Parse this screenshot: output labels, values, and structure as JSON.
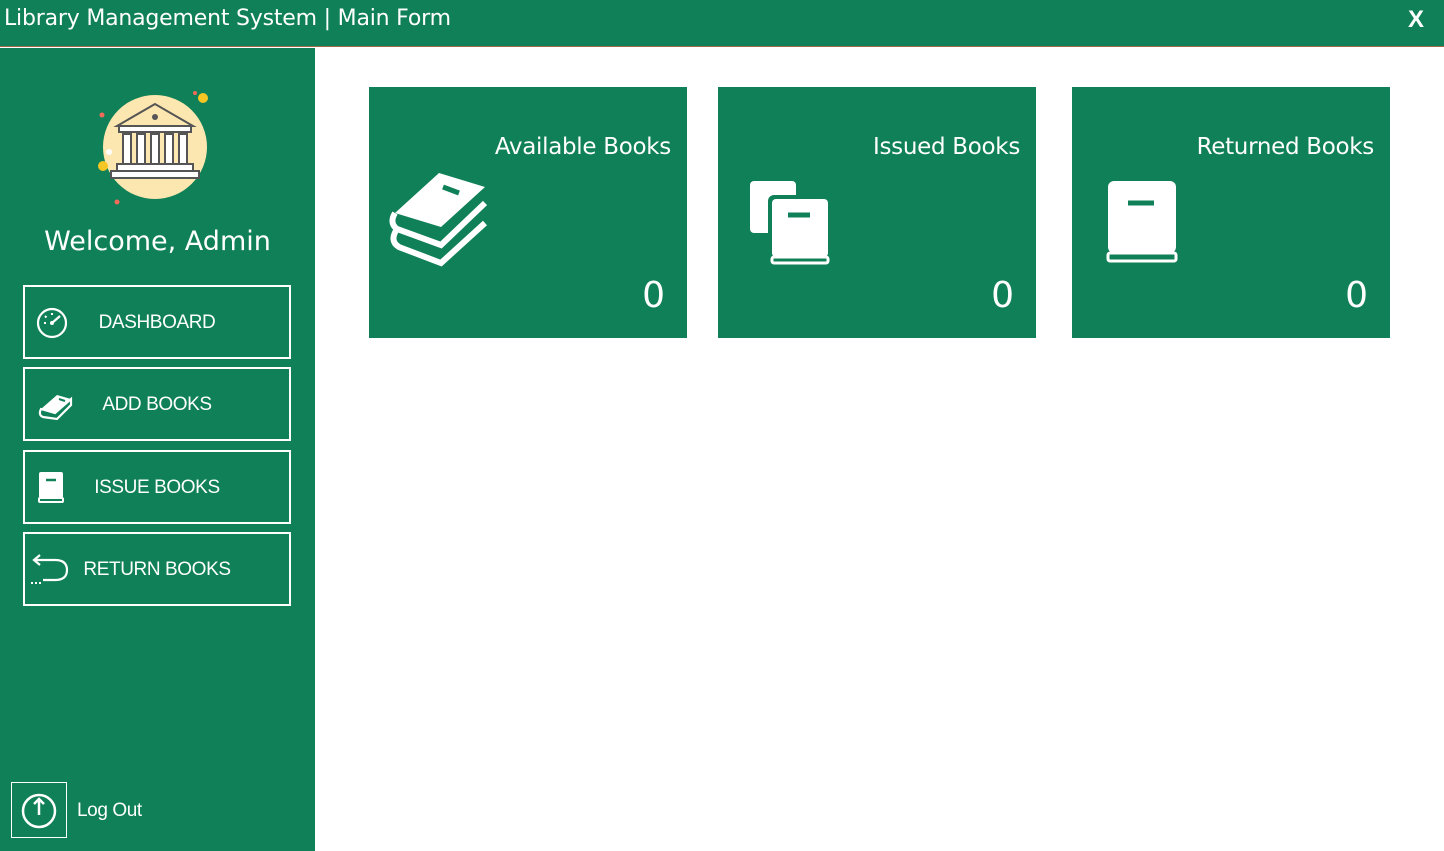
{
  "window": {
    "title": "Library Management System | Main Form",
    "close_label": "X"
  },
  "colors": {
    "primary": "#0f8057",
    "text": "#ffffff",
    "background": "#ffffff"
  },
  "sidebar": {
    "welcome": "Welcome, Admin",
    "items": [
      {
        "label": "DASHBOARD",
        "icon": "speedometer-icon"
      },
      {
        "label": "ADD BOOKS",
        "icon": "book-stack-icon"
      },
      {
        "label": "ISSUE BOOKS",
        "icon": "book-icon"
      },
      {
        "label": "RETURN BOOKS",
        "icon": "return-arrow-icon"
      }
    ],
    "logout_label": "Log Out"
  },
  "cards": [
    {
      "title": "Available Books",
      "count": "0",
      "icon": "books-icon"
    },
    {
      "title": "Issued Books",
      "count": "0",
      "icon": "books-copy-icon"
    },
    {
      "title": "Returned Books",
      "count": "0",
      "icon": "book-icon"
    }
  ]
}
